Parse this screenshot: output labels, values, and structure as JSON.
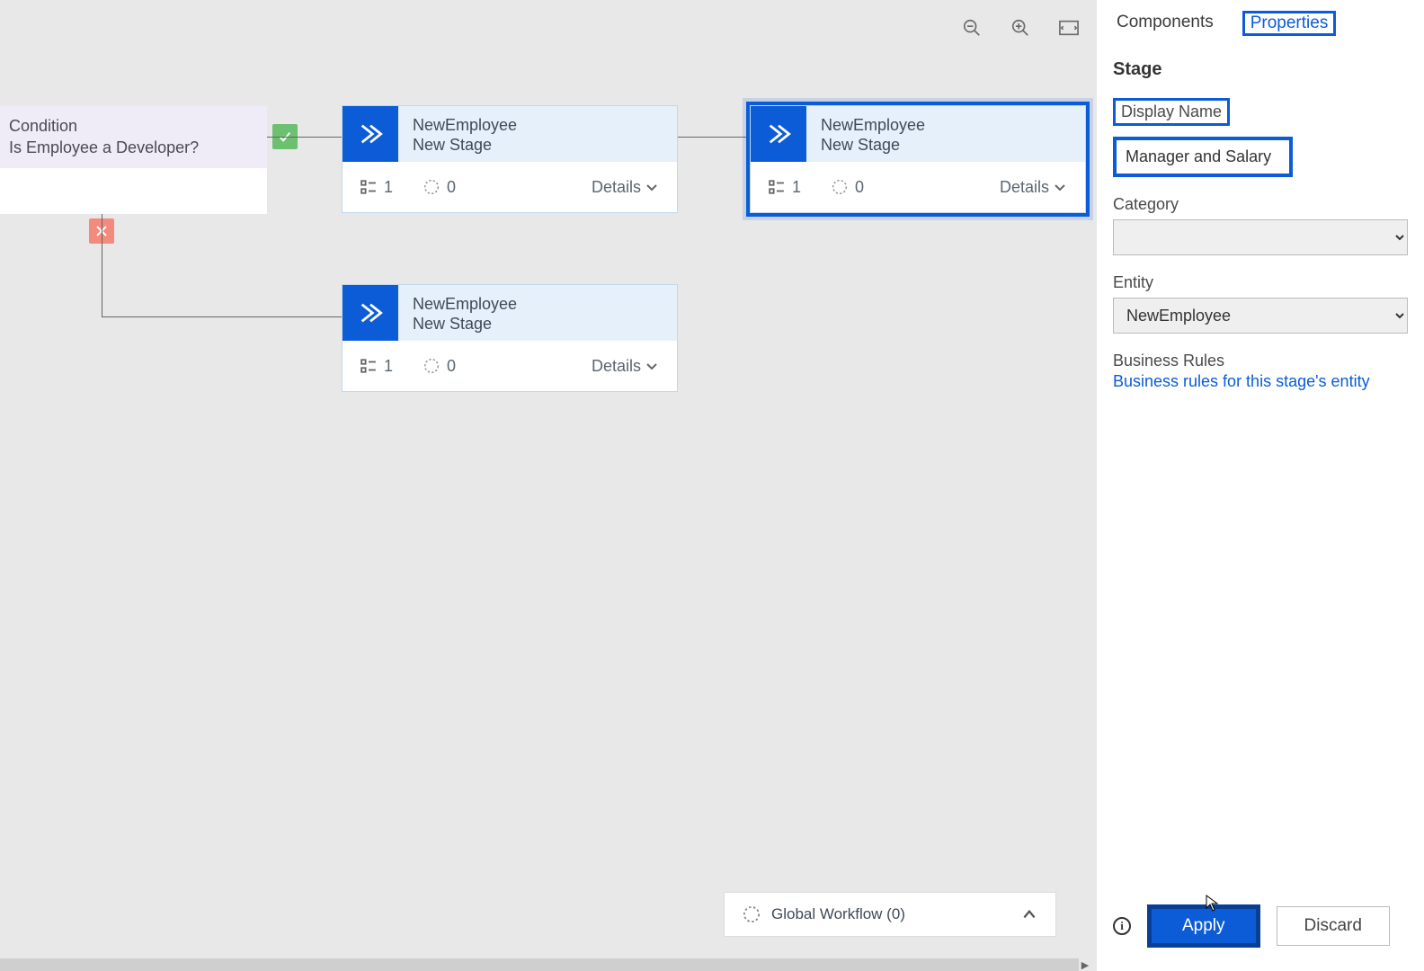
{
  "canvas": {
    "condition": {
      "label": "Condition",
      "text": "Is Employee a Developer?"
    },
    "stage1": {
      "entity": "NewEmployee",
      "name": "New Stage",
      "steps_count": "1",
      "triggers_count": "0",
      "details_label": "Details"
    },
    "stage2": {
      "entity": "NewEmployee",
      "name": "New Stage",
      "steps_count": "1",
      "triggers_count": "0",
      "details_label": "Details"
    },
    "stage3": {
      "entity": "NewEmployee",
      "name": "New Stage",
      "steps_count": "1",
      "triggers_count": "0",
      "details_label": "Details"
    },
    "global_workflow_label": "Global Workflow (0)"
  },
  "panel": {
    "tabs": {
      "components": "Components",
      "properties": "Properties"
    },
    "section_title": "Stage",
    "display_name_label": "Display Name",
    "display_name_value": "Manager and Salary",
    "category_label": "Category",
    "category_value": "",
    "entity_label": "Entity",
    "entity_value": "NewEmployee",
    "business_rules_label": "Business Rules",
    "business_rules_link": "Business rules for this stage's entity",
    "apply_label": "Apply",
    "discard_label": "Discard"
  }
}
